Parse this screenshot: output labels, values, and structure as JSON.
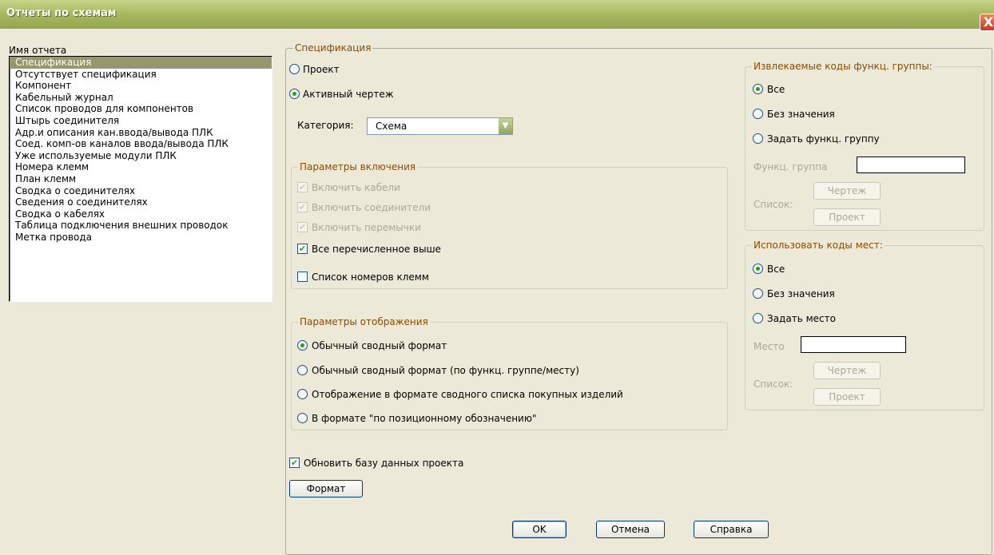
{
  "window": {
    "title": "Отчеты по схемам",
    "close_icon": "X"
  },
  "report_list": {
    "label": "Имя отчета",
    "items": [
      "Спецификация",
      "Отсутствует спецификация",
      "Компонент",
      "Кабельный журнал",
      "Список проводов для компонентов",
      "Штырь соединителя",
      "Адр.и описания кан.ввода/вывода ПЛК",
      "Соед. комп-ов каналов ввода/вывода ПЛК",
      "Уже используемые модули ПЛК",
      "Номера клемм",
      "План клемм",
      "Сводка о соединителях",
      "Сведения о соединителях",
      "Сводка о кабелях",
      "Таблица подключения внешних проводок",
      "Метка провода"
    ],
    "selected_index": 0
  },
  "spec": {
    "caption": "Спецификация",
    "radio_project": "Проект",
    "radio_active": "Активный чертеж",
    "selected": "active",
    "category_label": "Категория:",
    "category_value": "Схема"
  },
  "include": {
    "caption": "Параметры включения",
    "cables": "Включить кабели",
    "connectors": "Включить соединители",
    "jumpers": "Включить перемычки",
    "all_above": "Все перечисленное выше",
    "terminal_list": "Список номеров клемм"
  },
  "display": {
    "caption": "Параметры отображения",
    "opt1": "Обычный сводный формат",
    "opt2": "Обычный сводный формат (по функц. группе/месту)",
    "opt3": "Отображение в формате сводного списка покупных изделий",
    "opt4": "В формате \"по позиционному обозначению\"",
    "selected": 1
  },
  "func_group": {
    "caption": "Извлекаемые коды функц. группы:",
    "all": "Все",
    "empty": "Без значения",
    "set": "Задать функц. группу",
    "field_label": "Функц. группа",
    "list_label": "Список:",
    "btn_drawing": "Чертеж",
    "btn_project": "Проект"
  },
  "location": {
    "caption": "Использовать коды мест:",
    "all": "Все",
    "empty": "Без значения",
    "set": "Задать место",
    "field_label": "Место",
    "list_label": "Список:",
    "btn_drawing": "Чертеж",
    "btn_project": "Проект"
  },
  "update_db": "Обновить базу данных проекта",
  "format_btn": "Формат",
  "buttons": {
    "ok": "OK",
    "cancel": "Отмена",
    "help": "Справка"
  }
}
